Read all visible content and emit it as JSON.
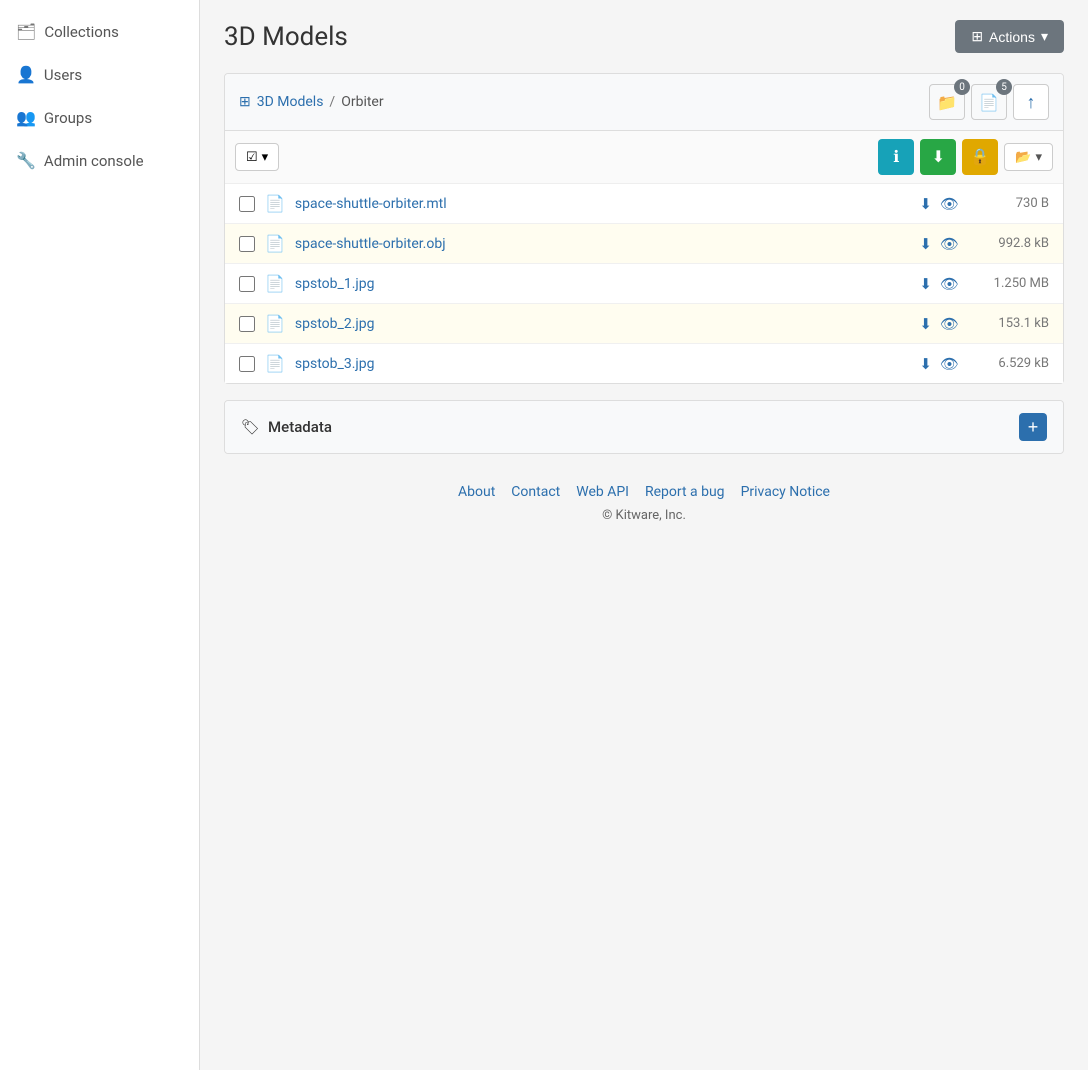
{
  "sidebar": {
    "items": [
      {
        "id": "collections",
        "label": "Collections",
        "icon": "🗂"
      },
      {
        "id": "users",
        "label": "Users",
        "icon": "👤"
      },
      {
        "id": "groups",
        "label": "Groups",
        "icon": "👥"
      },
      {
        "id": "admin-console",
        "label": "Admin console",
        "icon": "🔧"
      }
    ]
  },
  "header": {
    "title": "3D Models",
    "actions_label": "Actions"
  },
  "breadcrumb": {
    "root_label": "3D Models",
    "separator": "/",
    "current": "Orbiter"
  },
  "breadcrumb_actions": {
    "folder_badge": "0",
    "files_badge": "5"
  },
  "toolbar": {
    "check_label": "✓",
    "check_dropdown": "▾"
  },
  "files": [
    {
      "name": "space-shuttle-orbiter.mtl",
      "size": "730 B"
    },
    {
      "name": "space-shuttle-orbiter.obj",
      "size": "992.8 kB"
    },
    {
      "name": "spstob_1.jpg",
      "size": "1.250 MB"
    },
    {
      "name": "spstob_2.jpg",
      "size": "153.1 kB"
    },
    {
      "name": "spstob_3.jpg",
      "size": "6.529 kB"
    }
  ],
  "metadata": {
    "title": "Metadata",
    "add_btn": "+"
  },
  "footer": {
    "links": [
      {
        "id": "about",
        "label": "About"
      },
      {
        "id": "contact",
        "label": "Contact"
      },
      {
        "id": "web-api",
        "label": "Web API"
      },
      {
        "id": "report-bug",
        "label": "Report a bug"
      },
      {
        "id": "privacy-notice",
        "label": "Privacy Notice"
      }
    ],
    "copyright": "© Kitware, Inc."
  }
}
